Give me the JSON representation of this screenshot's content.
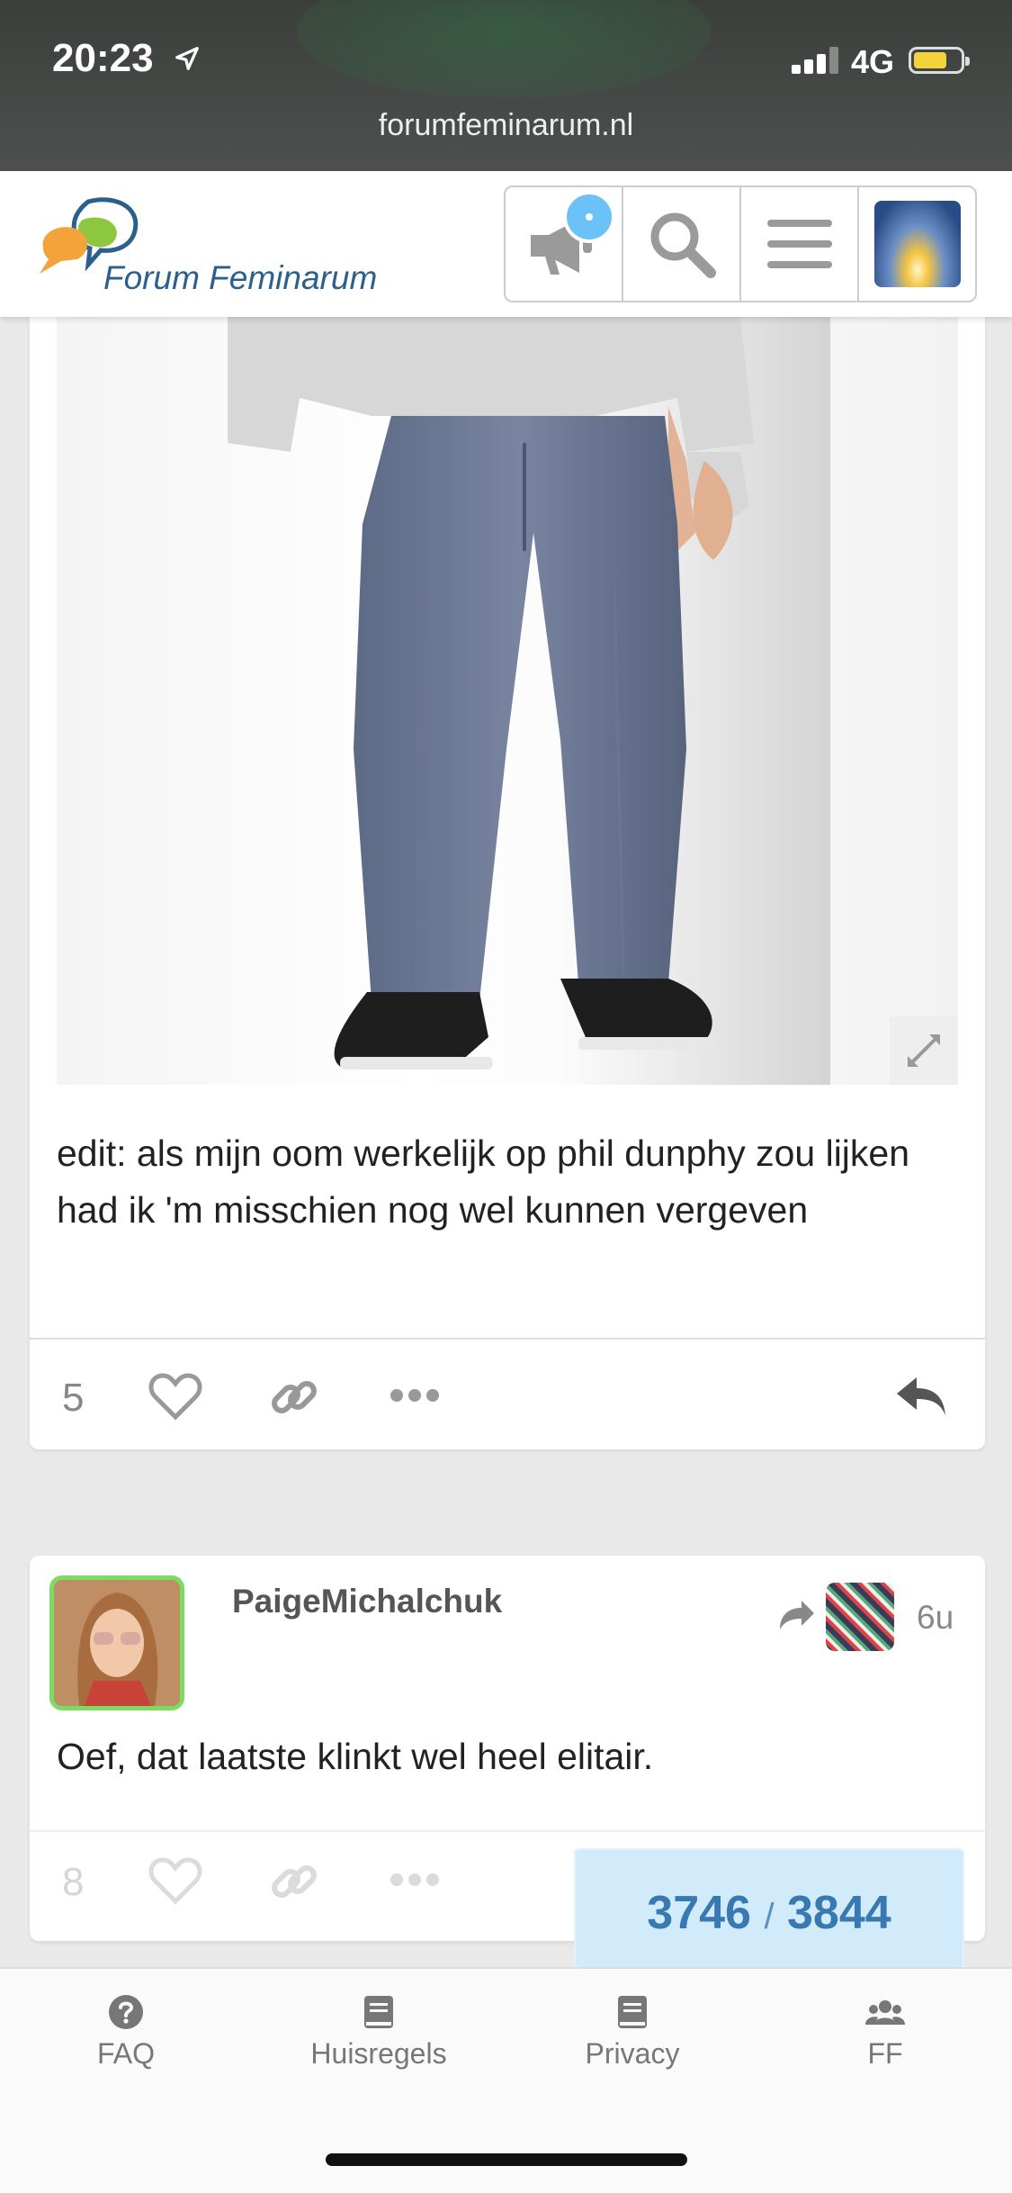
{
  "status_bar": {
    "time": "20:23",
    "network": "4G",
    "url": "forumfeminarum.nl"
  },
  "header": {
    "logo_text": "Forum Feminarum"
  },
  "post1": {
    "edit_text": "edit: als mijn oom werkelijk op phil dunphy zou lijken had ik 'm misschien nog wel kunnen vergeven",
    "like_count": "5"
  },
  "post2": {
    "username": "PaigeMichalchuk",
    "age": "6u",
    "text": "Oef, dat laatste klinkt wel heel elitair.",
    "like_count": "8"
  },
  "progress": {
    "current": "3746",
    "separator": "/",
    "total": "3844"
  },
  "bottom_nav": {
    "items": [
      {
        "label": "FAQ"
      },
      {
        "label": "Huisregels"
      },
      {
        "label": "Privacy"
      },
      {
        "label": "FF"
      }
    ]
  }
}
